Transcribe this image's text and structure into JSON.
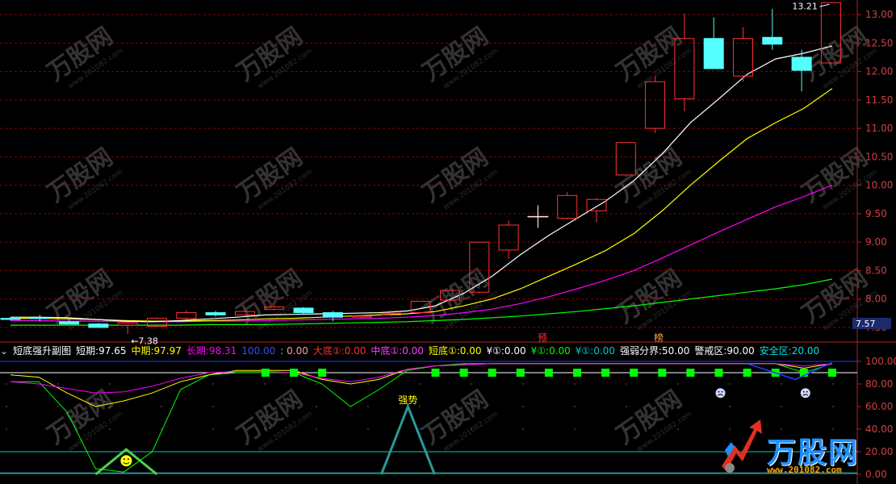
{
  "watermark": {
    "text": "万股网",
    "url": "www.201082.com"
  },
  "brand": {
    "logo_text": "万股网",
    "url_text": "www.201082.com"
  },
  "indicator": {
    "name": "短底强升副图",
    "short_label": "短期:",
    "short_value": "97.65",
    "mid_label": "中期:",
    "mid_value": "97.97",
    "long_label": "长期:",
    "long_value": "98.31",
    "hundred_value": "100.00",
    "sep_value": ": 0.00",
    "big_bottom_label": "大底①:",
    "big_bottom_value": "0.00",
    "mid_bottom_label": "中底①:",
    "mid_bottom_value": "0.00",
    "short_bottom_label": "短底①:",
    "short_bottom_value": "0.00",
    "y1_label": "¥①:",
    "y1_value": "0.00",
    "y2_label": "¥①:",
    "y2_value": "0.00",
    "y3_label": "¥①:",
    "y3_value": "0.00",
    "strong_weak_label": "强弱分界:",
    "strong_weak_value": "50.00",
    "warning_label": "警戒区:",
    "warning_value": "90.00",
    "safe_label": "安全区:",
    "safe_value": "20.00"
  },
  "markers": {
    "yu": "预",
    "bang": "榜",
    "strong": "强势"
  },
  "colors": {
    "up": "#ff3232",
    "down": "#54ffff",
    "ma5": "#ffffff",
    "ma10": "#ffff00",
    "ma20": "#ff00ff",
    "ma60": "#00ff00",
    "grid": "#8b0000",
    "axis": "#b22222"
  },
  "chart_data": [
    {
      "type": "candlestick",
      "ylim": [
        7.3,
        13.2
      ],
      "yticks": [
        7.5,
        8.0,
        8.5,
        9.0,
        9.5,
        10.0,
        10.5,
        11.0,
        11.5,
        12.0,
        12.5,
        13.0
      ],
      "ytick_labels": [
        "7.50",
        "8.00",
        "8.50",
        "9.00",
        "9.50",
        "10.00",
        "10.50",
        "11.00",
        "11.50",
        "12.00",
        "12.50",
        "13.00"
      ],
      "current_price_label": "7.57",
      "max_label": "13.21",
      "min_label": "7.38",
      "candles": [
        {
          "o": 7.66,
          "h": 7.68,
          "l": 7.62,
          "c": 7.64
        },
        {
          "o": 7.67,
          "h": 7.72,
          "l": 7.6,
          "c": 7.66
        },
        {
          "o": 7.6,
          "h": 7.64,
          "l": 7.56,
          "c": 7.56
        },
        {
          "o": 7.56,
          "h": 7.58,
          "l": 7.5,
          "c": 7.5
        },
        {
          "o": 7.54,
          "h": 7.6,
          "l": 7.38,
          "c": 7.58
        },
        {
          "o": 7.52,
          "h": 7.68,
          "l": 7.52,
          "c": 7.66
        },
        {
          "o": 7.66,
          "h": 7.8,
          "l": 7.64,
          "c": 7.76
        },
        {
          "o": 7.76,
          "h": 7.79,
          "l": 7.69,
          "c": 7.72
        },
        {
          "o": 7.72,
          "h": 7.83,
          "l": 7.7,
          "c": 7.78
        },
        {
          "o": 7.82,
          "h": 7.89,
          "l": 7.79,
          "c": 7.86
        },
        {
          "o": 7.84,
          "h": 7.86,
          "l": 7.74,
          "c": 7.76
        },
        {
          "o": 7.76,
          "h": 7.79,
          "l": 7.61,
          "c": 7.68
        },
        {
          "o": 7.68,
          "h": 7.72,
          "l": 7.65,
          "c": 7.7
        },
        {
          "o": 7.72,
          "h": 7.8,
          "l": 7.7,
          "c": 7.75
        },
        {
          "o": 7.76,
          "h": 7.96,
          "l": 7.75,
          "c": 7.96
        },
        {
          "o": 7.98,
          "h": 8.18,
          "l": 7.96,
          "c": 8.15
        },
        {
          "o": 8.12,
          "h": 9.0,
          "l": 8.1,
          "c": 9.0
        },
        {
          "o": 8.86,
          "h": 9.38,
          "l": 8.7,
          "c": 9.3
        },
        {
          "o": 9.45,
          "h": 9.6,
          "l": 9.25,
          "c": 9.45
        },
        {
          "o": 9.42,
          "h": 9.88,
          "l": 9.4,
          "c": 9.82
        },
        {
          "o": 9.55,
          "h": 9.78,
          "l": 9.35,
          "c": 9.75
        },
        {
          "o": 10.18,
          "h": 10.75,
          "l": 10.15,
          "c": 10.75
        },
        {
          "o": 11.0,
          "h": 11.92,
          "l": 10.92,
          "c": 11.82
        },
        {
          "o": 11.52,
          "h": 13.02,
          "l": 11.3,
          "c": 12.58
        },
        {
          "o": 12.58,
          "h": 12.95,
          "l": 12.05,
          "c": 12.05
        },
        {
          "o": 11.92,
          "h": 12.78,
          "l": 11.82,
          "c": 12.58
        },
        {
          "o": 12.6,
          "h": 13.1,
          "l": 12.38,
          "c": 12.48
        },
        {
          "o": 12.25,
          "h": 12.38,
          "l": 11.65,
          "c": 12.02
        },
        {
          "o": 12.15,
          "h": 13.21,
          "l": 12.12,
          "c": 13.21
        }
      ],
      "ma5": [
        7.68,
        7.68,
        7.67,
        7.64,
        7.61,
        7.6,
        7.62,
        7.65,
        7.68,
        7.72,
        7.73,
        7.74,
        7.75,
        7.76,
        7.79,
        7.88,
        8.1,
        8.4,
        8.78,
        9.12,
        9.42,
        9.72,
        10.08,
        10.55,
        11.1,
        11.52,
        11.95,
        12.22,
        12.32,
        12.45
      ],
      "ma10": [
        7.66,
        7.66,
        7.65,
        7.64,
        7.62,
        7.61,
        7.61,
        7.62,
        7.63,
        7.65,
        7.66,
        7.68,
        7.7,
        7.72,
        7.74,
        7.78,
        7.88,
        8.0,
        8.18,
        8.4,
        8.62,
        8.85,
        9.15,
        9.55,
        10.0,
        10.42,
        10.82,
        11.1,
        11.35,
        11.7
      ],
      "ma20": [
        7.62,
        7.62,
        7.61,
        7.61,
        7.6,
        7.6,
        7.6,
        7.61,
        7.61,
        7.62,
        7.63,
        7.64,
        7.65,
        7.66,
        7.68,
        7.71,
        7.76,
        7.82,
        7.92,
        8.04,
        8.18,
        8.33,
        8.5,
        8.72,
        8.95,
        9.18,
        9.4,
        9.62,
        9.8,
        10.0
      ],
      "ma60": [
        7.54,
        7.54,
        7.54,
        7.54,
        7.54,
        7.54,
        7.54,
        7.55,
        7.55,
        7.55,
        7.56,
        7.57,
        7.58,
        7.59,
        7.6,
        7.62,
        7.64,
        7.67,
        7.7,
        7.74,
        7.78,
        7.83,
        7.88,
        7.94,
        8.0,
        8.06,
        8.12,
        8.18,
        8.25,
        8.35
      ]
    },
    {
      "type": "line",
      "ylim": [
        0,
        100
      ],
      "yticks": [
        0,
        20,
        40,
        60,
        80,
        100
      ],
      "ytick_labels": [
        "0.00",
        "20.00",
        "40.00",
        "60.00",
        "80.00",
        "100.00"
      ],
      "series": [
        {
          "name": "短期",
          "values": [
            82,
            82,
            55,
            5,
            2,
            20,
            75,
            88,
            90,
            90,
            90,
            80,
            60,
            75,
            92,
            96,
            98,
            98,
            98,
            98,
            98,
            98,
            98,
            98,
            98,
            98,
            98,
            98,
            90,
            98
          ]
        },
        {
          "name": "中期",
          "values": [
            88,
            86,
            72,
            60,
            65,
            72,
            82,
            88,
            92,
            92,
            92,
            84,
            80,
            84,
            93,
            96,
            97,
            98,
            98,
            98,
            98,
            98,
            98,
            98,
            98,
            98,
            98,
            98,
            94,
            98
          ]
        },
        {
          "name": "长期",
          "values": [
            82,
            80,
            76,
            72,
            73,
            78,
            85,
            90,
            91,
            91,
            90,
            85,
            82,
            86,
            93,
            96,
            97,
            98,
            98,
            98,
            98,
            98,
            98,
            98,
            98,
            98,
            98,
            98,
            96,
            98
          ]
        }
      ],
      "warning_line": 90,
      "safe_line": 20,
      "green_blocks": [
        8,
        9,
        10,
        14,
        15,
        16,
        17,
        18,
        19,
        20,
        21,
        22,
        23,
        24,
        25,
        26,
        27,
        28
      ],
      "smiley_at": 4,
      "strong_peak_at": 14,
      "frown_at": [
        24,
        27
      ]
    }
  ]
}
